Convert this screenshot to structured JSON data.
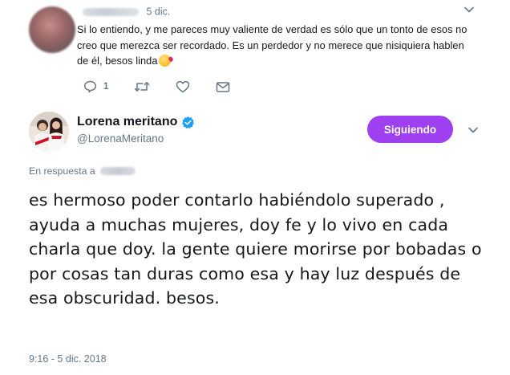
{
  "reply": {
    "date": "5 dic.",
    "text": "Si lo entiendo, y me pareces muy valiente de verdad es sólo que un tonto de esos no creo que merezca ser recordado. Es un perdedor y no merece que nisiquiera hablen de él, besos linda",
    "emoji_icon": "face-blowing-kiss-icon",
    "actions": {
      "reply_count": "1",
      "retweet_count": "",
      "like_count": ""
    }
  },
  "tweet": {
    "author_name": "Lorena meritano",
    "author_handle": "@LorenaMeritano",
    "verified": true,
    "follow_label": "Siguiendo",
    "in_reply_to_label": "En respuesta a",
    "text": "es hermoso poder contarlo habiéndolo superado , ayuda a muchas mujeres, doy fe y lo vivo en cada charla que doy. la gente quiere morirse por bobadas o por cosas tan duras como esa y hay luz después de esa obscuridad. besos.",
    "timestamp": "9:16 - 5 dic. 2018"
  },
  "colors": {
    "follow_button": "#9e3ff0",
    "verified_badge": "#1da1f2",
    "secondary_text": "#657786",
    "primary_text": "#14171a"
  }
}
